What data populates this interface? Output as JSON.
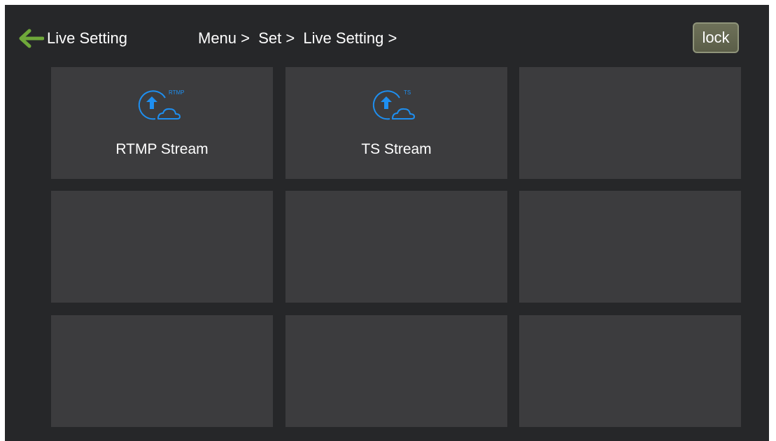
{
  "header": {
    "back_label": "Live Setting",
    "breadcrumb": "Menu >  Set >  Live Setting >",
    "lock_label": "lock"
  },
  "tiles": [
    {
      "label": "RTMP Stream",
      "icon": "upload-cloud-rtmp-icon",
      "tag": "RTMP"
    },
    {
      "label": "TS Stream",
      "icon": "upload-cloud-ts-icon",
      "tag": "TS"
    },
    {
      "label": ""
    },
    {
      "label": ""
    },
    {
      "label": ""
    },
    {
      "label": ""
    },
    {
      "label": ""
    },
    {
      "label": ""
    },
    {
      "label": ""
    }
  ],
  "colors": {
    "background": "#262729",
    "tile": "#3c3c3e",
    "accent_icon": "#1e8ff0",
    "back_arrow": "#6fa83a",
    "lock_button": "#646750"
  }
}
